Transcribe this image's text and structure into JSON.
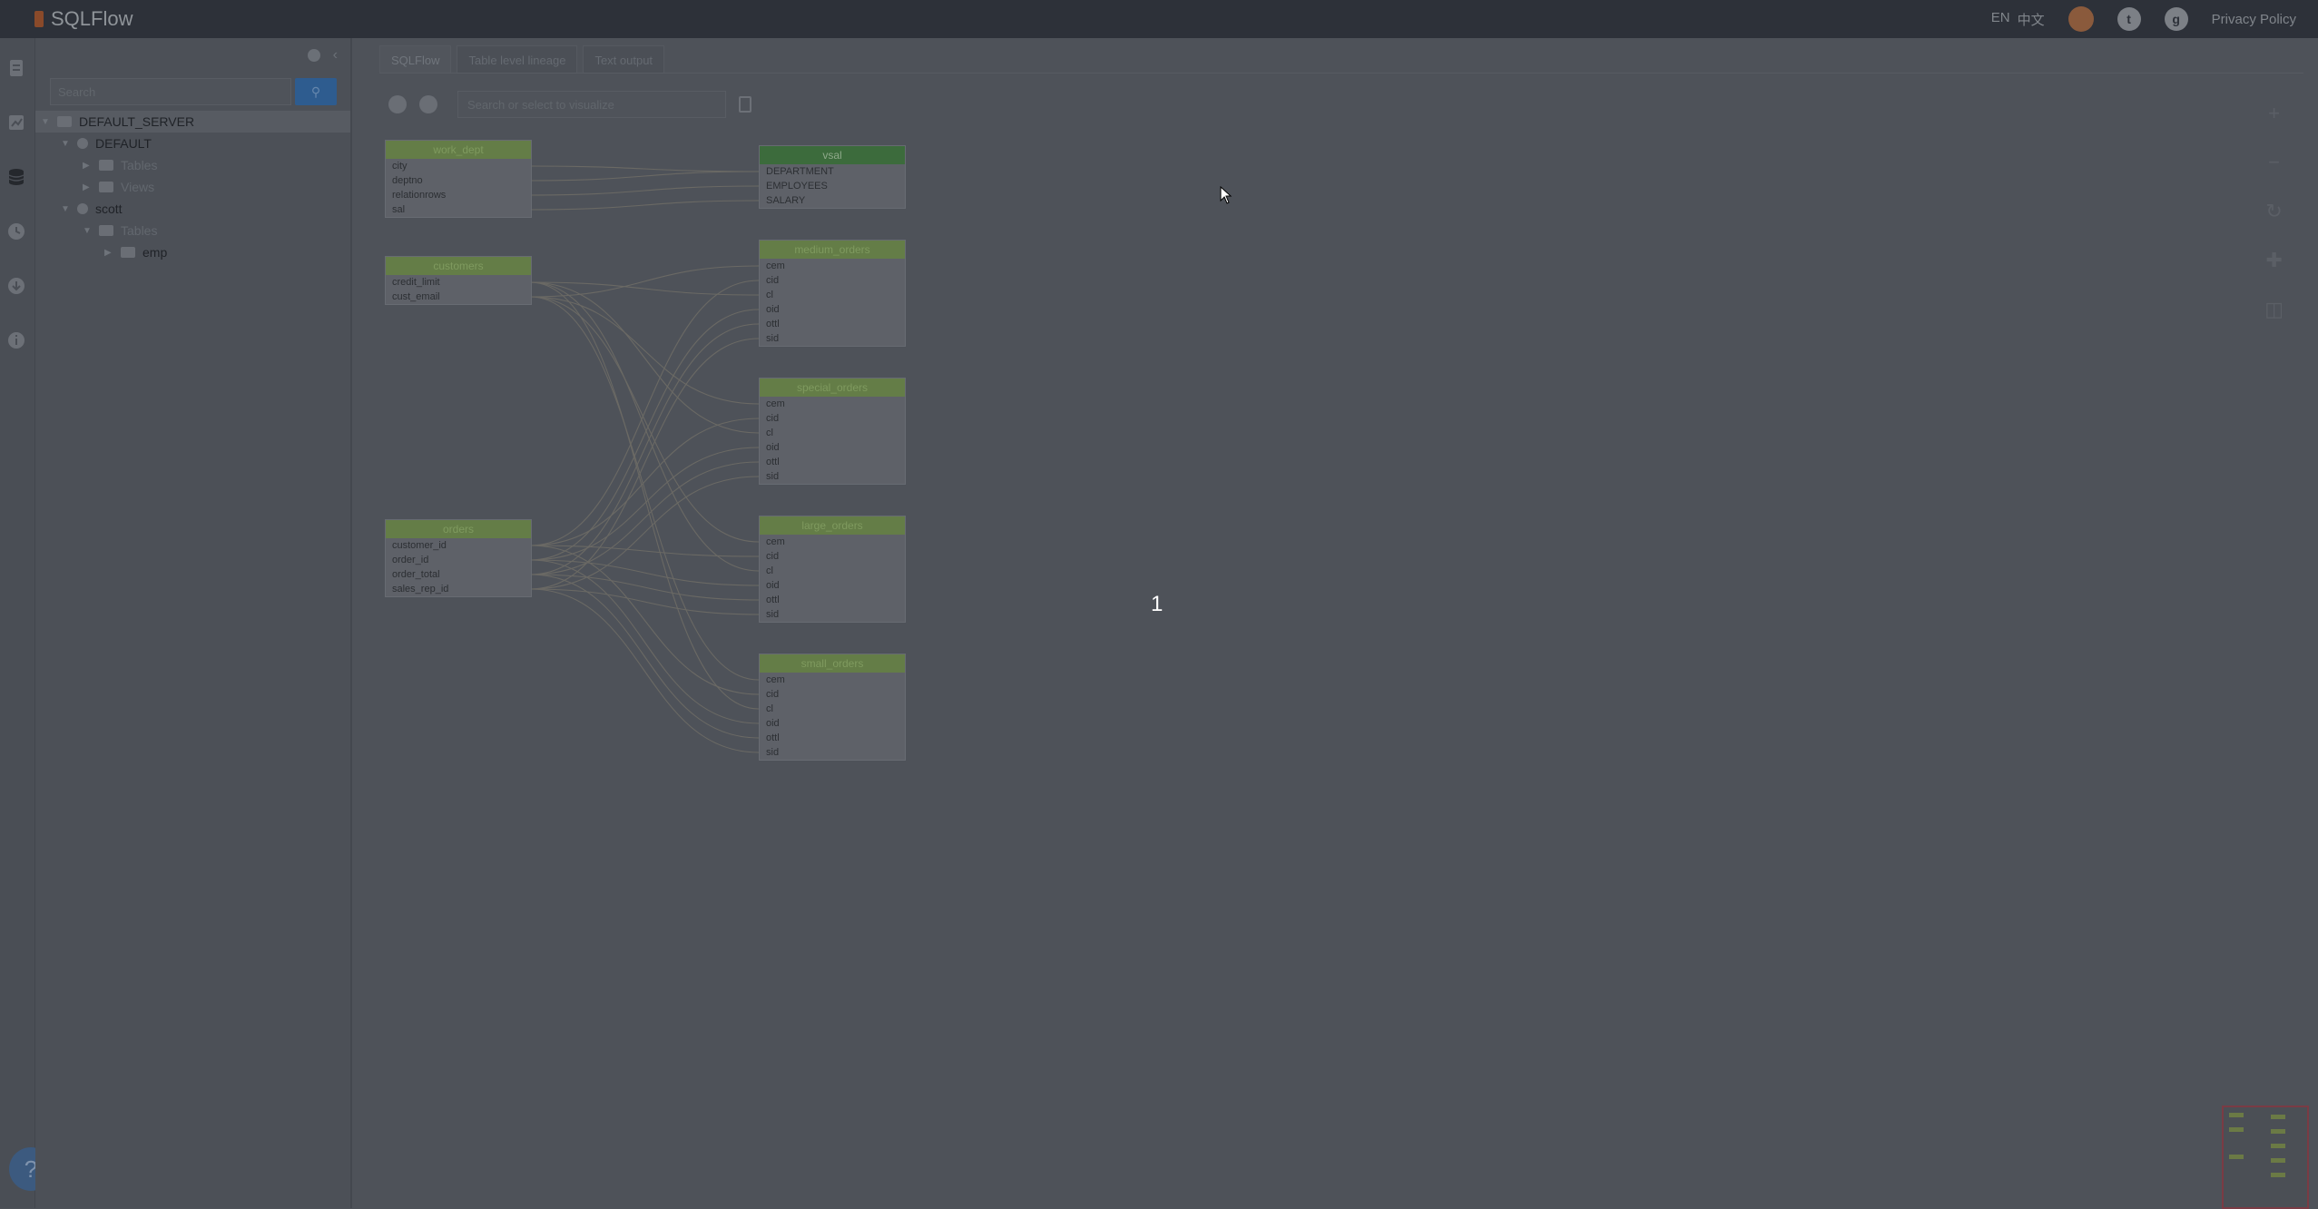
{
  "app": {
    "title": "SQLFlow"
  },
  "topbar": {
    "lang_en": "EN",
    "lang_zh": "中文",
    "privacy": "Privacy Policy"
  },
  "rail": {
    "icons": [
      "document-icon",
      "chart-icon",
      "database-icon",
      "history-icon",
      "download-icon",
      "info-icon"
    ],
    "help_label": "?"
  },
  "sidebar": {
    "search_placeholder": "Search",
    "tree": [
      {
        "label": "DEFAULT_SERVER",
        "level": 0
      },
      {
        "label": "DEFAULT",
        "level": 1
      },
      {
        "label": "Tables",
        "level": 2
      },
      {
        "label": "Views",
        "level": 2
      },
      {
        "label": "scott",
        "level": 1
      },
      {
        "label": "Tables",
        "level": 2
      },
      {
        "label": "emp",
        "level": 3
      }
    ]
  },
  "main": {
    "tabs": [
      "SQLFlow",
      "Table level lineage",
      "Text output"
    ],
    "visualize_placeholder": "Search or select to visualize",
    "overlay_number": "1"
  },
  "diagram": {
    "sources": [
      {
        "name": "work_dept",
        "columns": [
          "city",
          "deptno",
          "relationrows",
          "sal"
        ]
      },
      {
        "name": "customers",
        "columns": [
          "credit_limit",
          "cust_email"
        ]
      },
      {
        "name": "orders",
        "columns": [
          "customer_id",
          "order_id",
          "order_total",
          "sales_rep_id"
        ]
      }
    ],
    "targets": [
      {
        "name": "vsal",
        "columns": [
          "DEPARTMENT",
          "EMPLOYEES",
          "SALARY"
        ]
      },
      {
        "name": "medium_orders",
        "columns": [
          "cem",
          "cid",
          "cl",
          "oid",
          "ottl",
          "sid"
        ]
      },
      {
        "name": "special_orders",
        "columns": [
          "cem",
          "cid",
          "cl",
          "oid",
          "ottl",
          "sid"
        ]
      },
      {
        "name": "large_orders",
        "columns": [
          "cem",
          "cid",
          "cl",
          "oid",
          "ottl",
          "sid"
        ]
      },
      {
        "name": "small_orders",
        "columns": [
          "cem",
          "cid",
          "cl",
          "oid",
          "ottl",
          "sid"
        ]
      }
    ]
  }
}
